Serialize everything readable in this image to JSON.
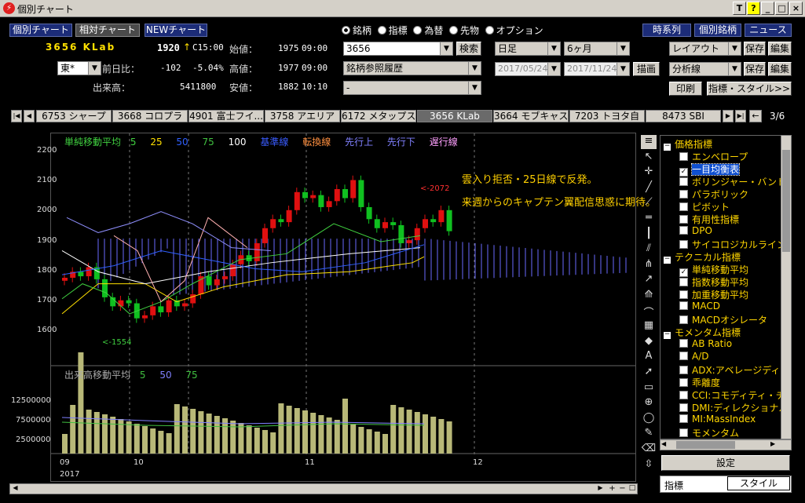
{
  "window": {
    "title": "個別チャート",
    "buttons": [
      "T",
      "?",
      "_",
      "□",
      "×"
    ]
  },
  "toptabs": [
    "個別チャート",
    "相対チャート",
    "NEWチャート"
  ],
  "rightnav": [
    "時系列",
    "個別銘柄",
    "ニュース"
  ],
  "stock": {
    "code_name": "3656 KLab",
    "price": "1920",
    "arrow": "↑",
    "time_label": "C15:00",
    "exchange": "東*",
    "prev_label": "前日比：",
    "change": "-102",
    "change_pct": "-5.04%",
    "volume_label": "出来高：",
    "volume": "5411800",
    "open_label": "始値：",
    "open": "1975",
    "open_time": "09:00",
    "high_label": "高値：",
    "high": "1977",
    "high_time": "09:00",
    "low_label": "安値：",
    "low": "1882",
    "low_time": "10:10"
  },
  "radios": [
    "銘柄",
    "指標",
    "為替",
    "先物",
    "オプション"
  ],
  "search": {
    "value": "3656",
    "button": "検索",
    "history": "銘柄参照履歴",
    "third": "-"
  },
  "period": {
    "interval": "日足",
    "range": "6ヶ月",
    "from": "2017/05/24",
    "to": "2017/11/24",
    "draw": "描画"
  },
  "layout": {
    "layout": "レイアウト",
    "save": "保存",
    "edit": "編集",
    "analysis": "分析線",
    "print": "印刷",
    "style": "指標・スタイル>>"
  },
  "stocktabs": [
    "6753 シャープ",
    "3668 コロプラ",
    "4901 富士フイ...",
    "3758 アエリア",
    "6172 メタップス",
    "3656 KLab",
    "3664 モブキャス",
    "7203 トヨタ自",
    "8473 SBI"
  ],
  "pager": "3/6",
  "legend": {
    "sma": "単純移動平均",
    "p5": "5",
    "p25": "25",
    "p50": "50",
    "p75": "75",
    "p100": "100",
    "kijun": "基準線",
    "tenkan": "転換線",
    "senkoA": "先行上",
    "senkoB": "先行下",
    "chikou": "遅行線",
    "vol": "出来高移動平均",
    "v5": "5",
    "v50": "50",
    "v75": "75"
  },
  "annotation": {
    "line1": "雲入り拒否・25日線で反発。",
    "line2": "来週からのキャプテン翼配信思惑に期待。",
    "hi": "<-2072",
    "lo": "<-1554"
  },
  "yaxis": [
    "2200",
    "2100",
    "2000",
    "1900",
    "1800",
    "1700",
    "1600"
  ],
  "vaxis": [
    "12500000",
    "7500000",
    "2500000"
  ],
  "xaxis": {
    "m9": "09",
    "m10": "10",
    "m11": "11",
    "m12": "12",
    "year": "2017"
  },
  "tree": [
    {
      "t": "cat",
      "label": "価格指標",
      "x": 4,
      "exp": "−"
    },
    {
      "t": "item",
      "label": "エンベロープ",
      "x": 24
    },
    {
      "t": "item",
      "label": "一目均衡表",
      "x": 24,
      "checked": true,
      "sel": true
    },
    {
      "t": "item",
      "label": "ボリンジャー・バンド",
      "x": 24
    },
    {
      "t": "item",
      "label": "パラボリック",
      "x": 24
    },
    {
      "t": "item",
      "label": "ピボット",
      "x": 24
    },
    {
      "t": "item",
      "label": "有用性指標",
      "x": 24
    },
    {
      "t": "item",
      "label": "DPO",
      "x": 24
    },
    {
      "t": "item",
      "label": "サイコロジカルライン",
      "x": 24
    },
    {
      "t": "cat",
      "label": "テクニカル指標",
      "x": 4,
      "exp": "−"
    },
    {
      "t": "item",
      "label": "単純移動平均",
      "x": 24,
      "checked": true
    },
    {
      "t": "item",
      "label": "指数移動平均",
      "x": 24
    },
    {
      "t": "item",
      "label": "加重移動平均",
      "x": 24
    },
    {
      "t": "item",
      "label": "MACD",
      "x": 24
    },
    {
      "t": "item",
      "label": "MACDオシレータ",
      "x": 24
    },
    {
      "t": "cat",
      "label": "モメンタム指標",
      "x": 4,
      "exp": "−"
    },
    {
      "t": "item",
      "label": "AB Ratio",
      "x": 24
    },
    {
      "t": "item",
      "label": "A/D",
      "x": 24
    },
    {
      "t": "item",
      "label": "ADX:アベレージディレ",
      "x": 24
    },
    {
      "t": "item",
      "label": "乖離度",
      "x": 24
    },
    {
      "t": "item",
      "label": "CCI:コモディティ・チャ",
      "x": 24
    },
    {
      "t": "item",
      "label": "DMI:ディレクショナル",
      "x": 24
    },
    {
      "t": "item",
      "label": "MI:MassIndex",
      "x": 24
    },
    {
      "t": "item",
      "label": "モメンタム",
      "x": 24
    }
  ],
  "settings": "設定",
  "bottomtabs": [
    "指標",
    "スタイル"
  ],
  "colors": {
    "up": "#e01010",
    "down": "#10c020",
    "cloud": "#8080ff",
    "yellowtext": "#ffd000"
  }
}
